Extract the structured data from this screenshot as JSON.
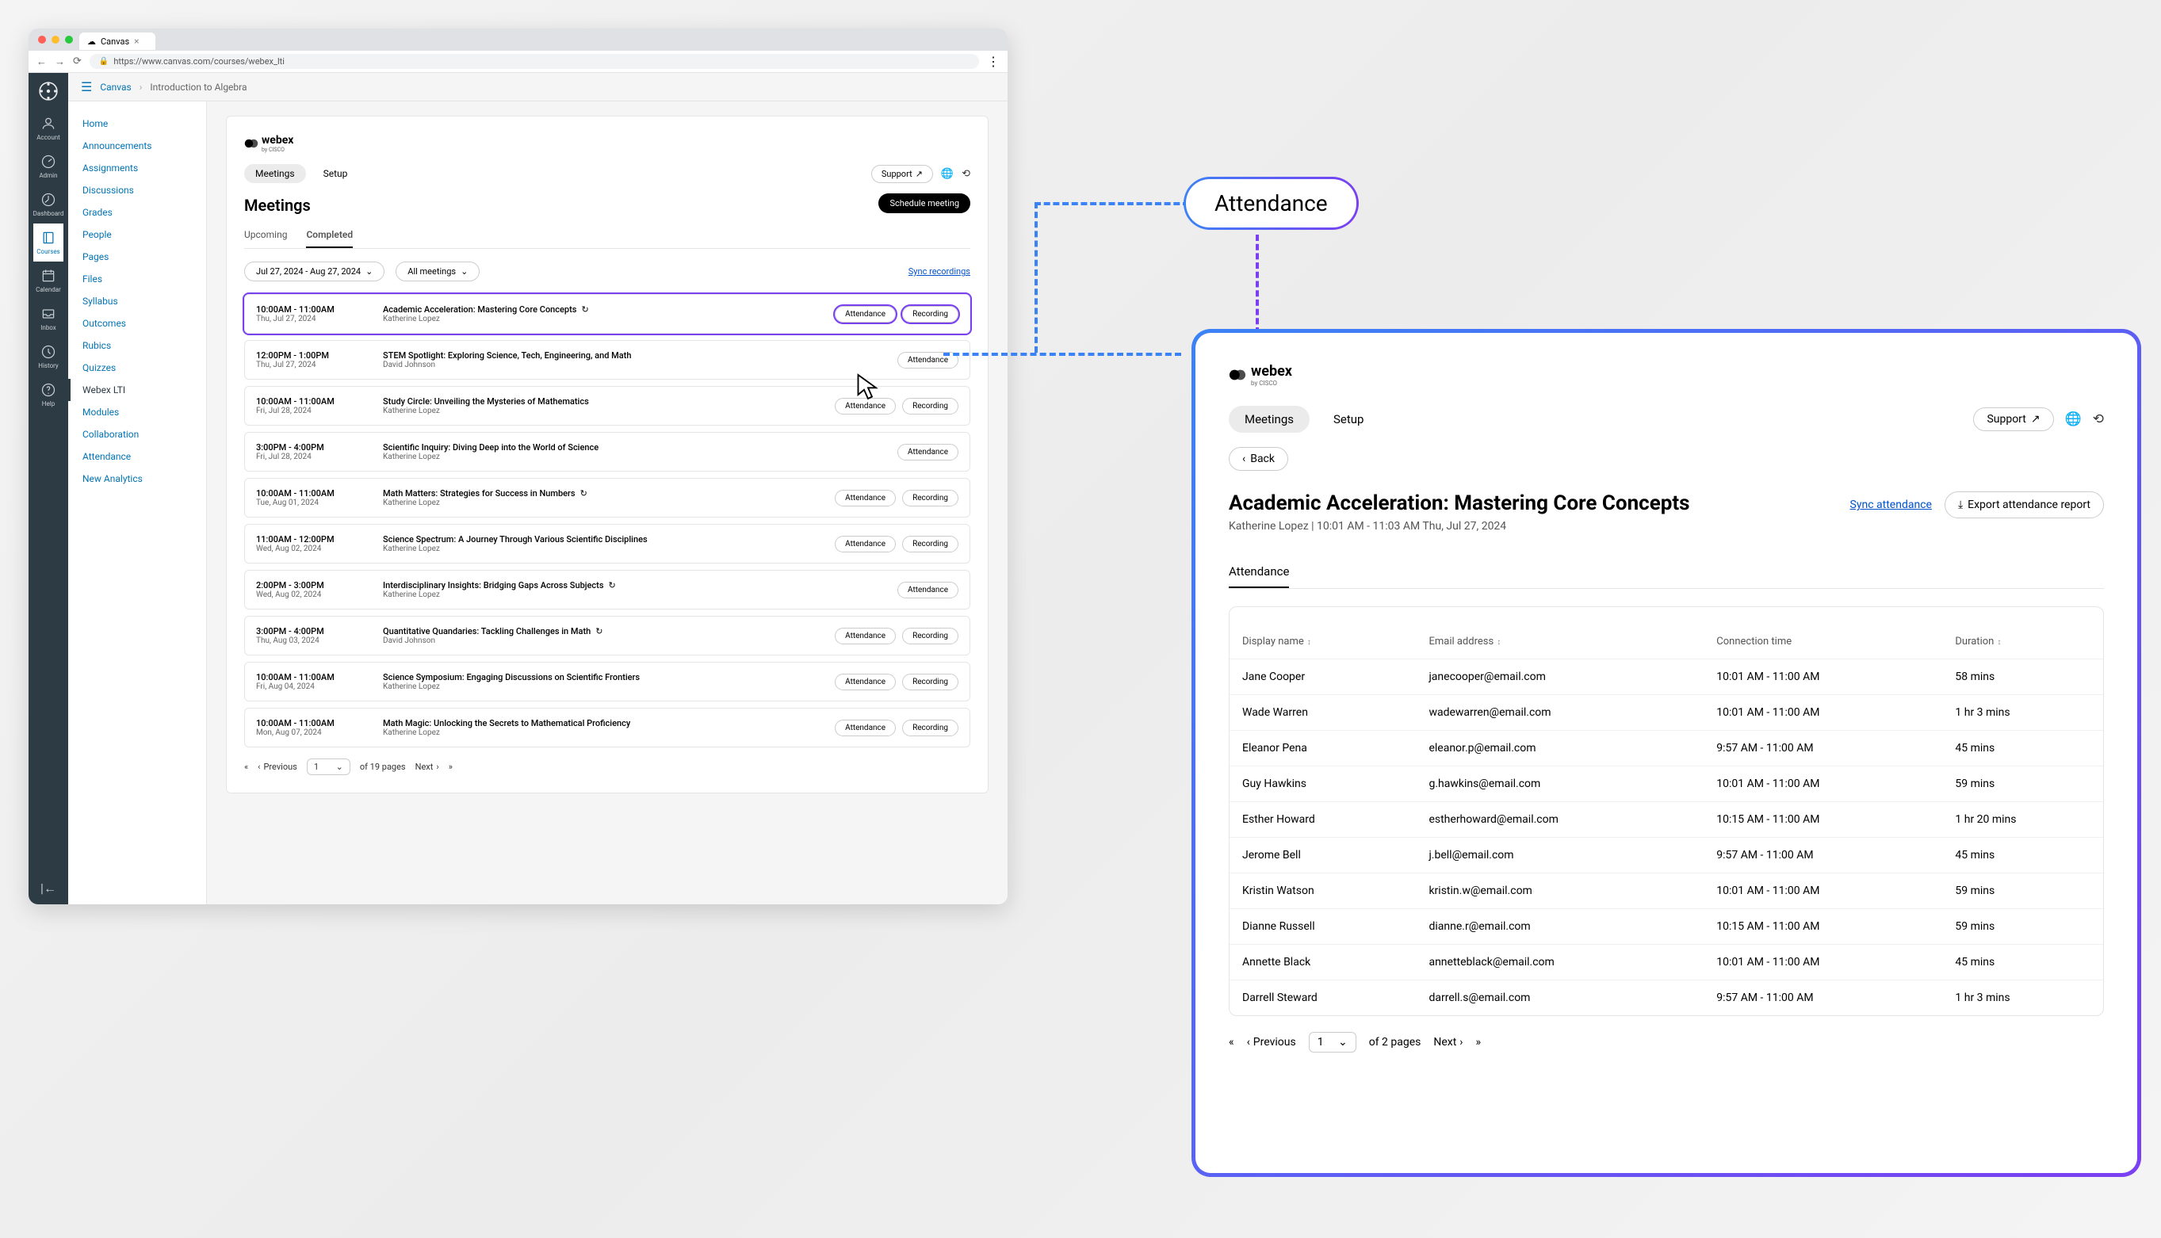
{
  "browser": {
    "tab_icon": "☁",
    "tab_title": "Canvas",
    "url": "https://www.canvas.com/courses/webex_lti"
  },
  "global_nav": [
    {
      "label": "Account",
      "icon": "user"
    },
    {
      "label": "Admin",
      "icon": "gauge"
    },
    {
      "label": "Dashboard",
      "icon": "dash"
    },
    {
      "label": "Courses",
      "icon": "book",
      "active": true
    },
    {
      "label": "Calendar",
      "icon": "calendar"
    },
    {
      "label": "Inbox",
      "icon": "inbox"
    },
    {
      "label": "History",
      "icon": "clock"
    },
    {
      "label": "Help",
      "icon": "help"
    }
  ],
  "breadcrumb": {
    "root": "Canvas",
    "current": "Introduction to Algebra"
  },
  "course_nav": [
    "Home",
    "Announcements",
    "Assignments",
    "Discussions",
    "Grades",
    "People",
    "Pages",
    "Files",
    "Syllabus",
    "Outcomes",
    "Rubics",
    "Quizzes",
    "Webex LTI",
    "Modules",
    "Collaboration",
    "Attendance",
    "New Analytics"
  ],
  "course_nav_active": "Webex LTI",
  "webex": {
    "brand": "webex",
    "brand_sub": "by CISCO",
    "tabs": {
      "meetings": "Meetings",
      "setup": "Setup"
    },
    "support": "Support",
    "section_title": "Meetings",
    "schedule_btn": "Schedule meeting",
    "subtabs": {
      "upcoming": "Upcoming",
      "completed": "Completed"
    },
    "date_filter": "Jul 27, 2024 - Aug 27, 2024",
    "type_filter": "All meetings",
    "sync_recordings": "Sync recordings",
    "attendance_label": "Attendance",
    "recording_label": "Recording"
  },
  "meetings": [
    {
      "time": "10:00AM - 11:00AM",
      "date": "Thu, Jul 27, 2024",
      "title": "Academic Acceleration: Mastering Core Concepts",
      "host": "Katherine Lopez",
      "recurring": true,
      "attendance": true,
      "recording": true,
      "highlighted": true
    },
    {
      "time": "12:00PM - 1:00PM",
      "date": "Thu, Jul 27, 2024",
      "title": "STEM Spotlight: Exploring Science, Tech, Engineering, and Math",
      "host": "David Johnson",
      "recurring": false,
      "attendance": true,
      "recording": false
    },
    {
      "time": "10:00AM - 11:00AM",
      "date": "Fri, Jul 28, 2024",
      "title": "Study Circle: Unveiling the Mysteries of Mathematics",
      "host": "Katherine Lopez",
      "recurring": false,
      "attendance": true,
      "recording": true
    },
    {
      "time": "3:00PM - 4:00PM",
      "date": "Fri, Jul 28, 2024",
      "title": "Scientific Inquiry: Diving Deep into the World of Science",
      "host": "Katherine Lopez",
      "recurring": false,
      "attendance": true,
      "recording": false
    },
    {
      "time": "10:00AM - 11:00AM",
      "date": "Tue, Aug 01, 2024",
      "title": "Math Matters: Strategies for Success in Numbers",
      "host": "Katherine Lopez",
      "recurring": true,
      "attendance": true,
      "recording": true
    },
    {
      "time": "11:00AM - 12:00PM",
      "date": "Wed, Aug 02, 2024",
      "title": "Science Spectrum: A Journey Through Various Scientific Disciplines",
      "host": "Katherine Lopez",
      "recurring": false,
      "attendance": true,
      "recording": true
    },
    {
      "time": "2:00PM - 3:00PM",
      "date": "Wed, Aug 02, 2024",
      "title": "Interdisciplinary Insights: Bridging Gaps Across Subjects",
      "host": "Katherine Lopez",
      "recurring": true,
      "attendance": true,
      "recording": false
    },
    {
      "time": "3:00PM - 4:00PM",
      "date": "Thu, Aug 03, 2024",
      "title": "Quantitative Quandaries: Tackling Challenges in Math",
      "host": "David Johnson",
      "recurring": true,
      "attendance": true,
      "recording": true
    },
    {
      "time": "10:00AM - 11:00AM",
      "date": "Fri, Aug 04, 2024",
      "title": "Science Symposium: Engaging Discussions on Scientific Frontiers",
      "host": "Katherine Lopez",
      "recurring": false,
      "attendance": true,
      "recording": true
    },
    {
      "time": "10:00AM - 11:00AM",
      "date": "Mon, Aug 07, 2024",
      "title": "Math Magic: Unlocking the Secrets to Mathematical Proficiency",
      "host": "Katherine Lopez",
      "recurring": false,
      "attendance": true,
      "recording": true
    }
  ],
  "pagination": {
    "prev": "Previous",
    "next": "Next",
    "current": "1",
    "of_pages": "of 19 pages"
  },
  "callout": {
    "label": "Attendance"
  },
  "detail": {
    "back": "Back",
    "title": "Academic Acceleration: Mastering Core Concepts",
    "subtitle": "Katherine Lopez | 10:01 AM - 11:03 AM Thu, Jul 27, 2024",
    "sync": "Sync attendance",
    "export": "Export attendance report",
    "tab": "Attendance",
    "columns": {
      "name": "Display name",
      "email": "Email address",
      "conn": "Connection time",
      "dur": "Duration"
    },
    "rows": [
      {
        "name": "Jane Cooper",
        "email": "janecooper@email.com",
        "conn": "10:01 AM - 11:00 AM",
        "dur": "58 mins"
      },
      {
        "name": "Wade Warren",
        "email": "wadewarren@email.com",
        "conn": "10:01 AM - 11:00 AM",
        "dur": "1 hr 3 mins"
      },
      {
        "name": "Eleanor Pena",
        "email": "eleanor.p@email.com",
        "conn": "9:57 AM - 11:00 AM",
        "dur": "45 mins"
      },
      {
        "name": "Guy Hawkins",
        "email": "g.hawkins@email.com",
        "conn": "10:01 AM - 11:00 AM",
        "dur": "59 mins"
      },
      {
        "name": "Esther Howard",
        "email": "estherhoward@email.com",
        "conn": "10:15 AM - 11:00 AM",
        "dur": "1 hr 20 mins"
      },
      {
        "name": "Jerome Bell",
        "email": "j.bell@email.com",
        "conn": "9:57 AM - 11:00 AM",
        "dur": "45 mins"
      },
      {
        "name": "Kristin Watson",
        "email": "kristin.w@email.com",
        "conn": "10:01 AM - 11:00 AM",
        "dur": "59 mins"
      },
      {
        "name": "Dianne Russell",
        "email": "dianne.r@email.com",
        "conn": "10:15 AM - 11:00 AM",
        "dur": "59 mins"
      },
      {
        "name": "Annette Black",
        "email": "annetteblack@email.com",
        "conn": "10:01 AM - 11:00 AM",
        "dur": "45 mins"
      },
      {
        "name": "Darrell Steward",
        "email": "darrell.s@email.com",
        "conn": "9:57 AM - 11:00 AM",
        "dur": "1 hr 3 mins"
      }
    ],
    "pagination": {
      "prev": "Previous",
      "next": "Next",
      "current": "1",
      "of_pages": "of 2 pages"
    }
  }
}
